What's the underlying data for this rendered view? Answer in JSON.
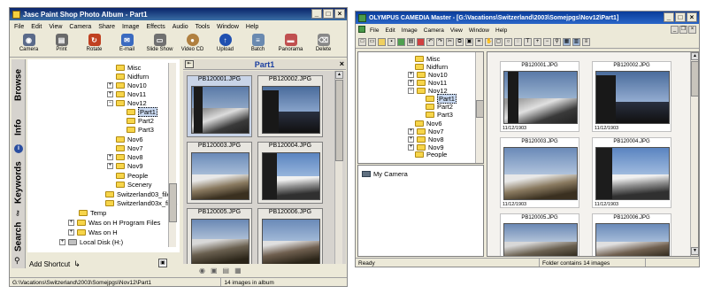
{
  "psp": {
    "title": "Jasc Paint Shop Photo Album - Part1",
    "menu": [
      "File",
      "Edit",
      "View",
      "Camera",
      "Share",
      "Image",
      "Effects",
      "Audio",
      "Tools",
      "Window",
      "Help"
    ],
    "toolbar": [
      "Camera",
      "Print",
      "Rotate",
      "E-mail",
      "Slide Show",
      "Video CD",
      "Upload",
      "Batch",
      "Panorama",
      "Delete"
    ],
    "side_tabs": [
      "Browse",
      "Info",
      "Keywords",
      "Search"
    ],
    "tree": [
      "Misc",
      "Nidfurn",
      "Nov10",
      "Nov11",
      "Nov12",
      "Part1",
      "Part2",
      "Part3",
      "Nov6",
      "Nov7",
      "Nov8",
      "Nov9",
      "People",
      "Scenery",
      "Switzerland03_files",
      "Switzerland03x_files",
      "Temp",
      "Was on H Program Files",
      "Was on H",
      "Local Disk (H:)"
    ],
    "add_shortcut": "Add Shortcut",
    "album_title": "Part1",
    "photos": [
      "PB120001.JPG",
      "PB120002.JPG",
      "PB120003.JPG",
      "PB120004.JPG",
      "PB120005.JPG",
      "PB120006.JPG"
    ],
    "status_path": "G:\\Vacations\\Switzerland\\2003\\Somejpgs\\Nov12\\Part1",
    "status_count": "14 images in album"
  },
  "oly": {
    "title": "OLYMPUS CAMEDIA Master - [G:\\Vacations\\Switzerland\\2003\\Somejpgs\\Nov12\\Part1]",
    "menu": [
      "File",
      "Edit",
      "Image",
      "Camera",
      "View",
      "Window",
      "Help"
    ],
    "tree": [
      "Misc",
      "Nidfurn",
      "Nov10",
      "Nov11",
      "Nov12",
      "Part1",
      "Part2",
      "Part3",
      "Nov6",
      "Nov7",
      "Nov8",
      "Nov9",
      "People"
    ],
    "my_camera": "My Camera",
    "photos": [
      "PB120001.JPG",
      "PB120002.JPG",
      "PB120003.JPG",
      "PB120004.JPG",
      "PB120005.JPG",
      "PB120006.JPG"
    ],
    "dates": [
      "11/12/1903",
      "11/12/1903",
      "11/12/1903",
      "11/12/1903"
    ],
    "status_ready": "Ready",
    "status_count": "Folder contains 14 images"
  },
  "colors": {
    "titlebar": "#0a246a",
    "selection": "#c8d8f0",
    "folder": "#f7d54a"
  }
}
